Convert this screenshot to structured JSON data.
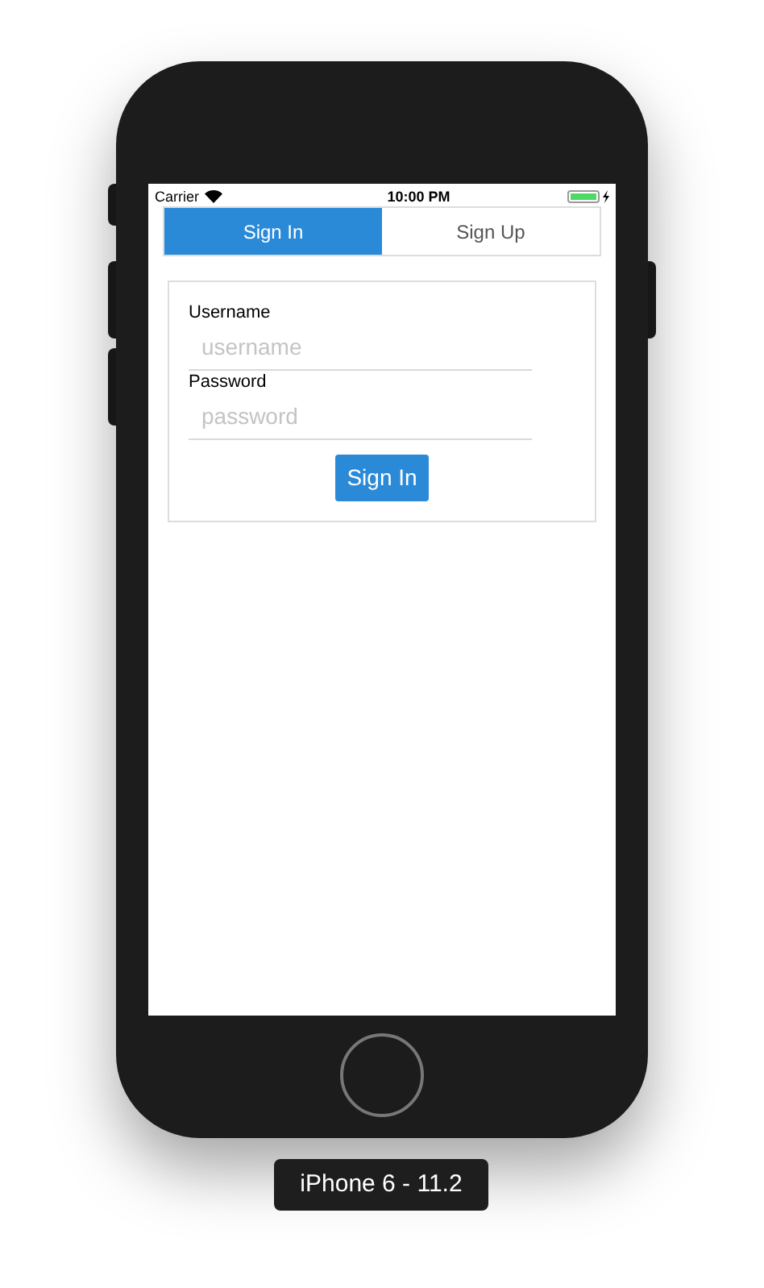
{
  "status_bar": {
    "carrier": "Carrier",
    "time": "10:00 PM"
  },
  "tabs": [
    {
      "label": "Sign In",
      "selected": true
    },
    {
      "label": "Sign Up",
      "selected": false
    }
  ],
  "form": {
    "fields": [
      {
        "label": "Username",
        "placeholder": "username"
      },
      {
        "label": "Password",
        "placeholder": "password"
      }
    ],
    "button": "Sign In"
  },
  "device_label": "iPhone 6 - 11.2"
}
